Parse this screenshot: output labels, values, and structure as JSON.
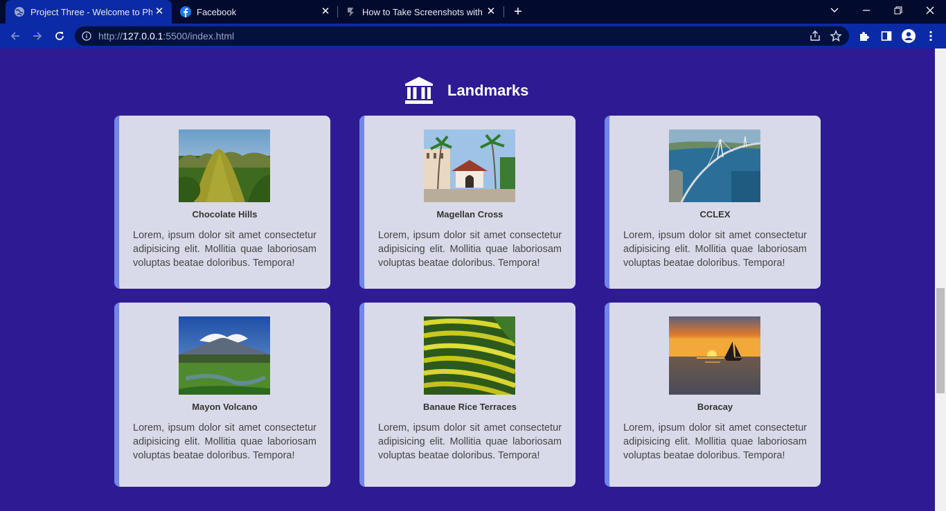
{
  "browser": {
    "tabs": [
      {
        "title": "Project Three - Welcome to Philip",
        "favicon": "globe-icon",
        "active": true
      },
      {
        "title": "Facebook",
        "favicon": "facebook-icon",
        "active": false
      },
      {
        "title": "How to Take Screenshots with Du",
        "favicon": "page-icon",
        "active": false
      }
    ],
    "new_tab": "+",
    "address": {
      "protocol": "http://",
      "host": "127.0.0.1",
      "path": ":5500/index.html"
    }
  },
  "colors": {
    "page_bg": "#2e1a93",
    "card_bg": "#d9dae9",
    "card_accent": "#7285e8",
    "chrome_bg": "#0b2aa6"
  },
  "section": {
    "title": "Landmarks",
    "icon": "bank-icon"
  },
  "landmarks": [
    {
      "name": "Chocolate Hills",
      "description": "Lorem, ipsum dolor sit amet consectetur adipisicing elit. Mollitia quae laboriosam voluptas beatae doloribus. Tempora!"
    },
    {
      "name": "Magellan Cross",
      "description": "Lorem, ipsum dolor sit amet consectetur adipisicing elit. Mollitia quae laboriosam voluptas beatae doloribus. Tempora!"
    },
    {
      "name": "CCLEX",
      "description": "Lorem, ipsum dolor sit amet consectetur adipisicing elit. Mollitia quae laboriosam voluptas beatae doloribus. Tempora!"
    },
    {
      "name": "Mayon Volcano",
      "description": "Lorem, ipsum dolor sit amet consectetur adipisicing elit. Mollitia quae laboriosam voluptas beatae doloribus. Tempora!"
    },
    {
      "name": "Banaue Rice Terraces",
      "description": "Lorem, ipsum dolor sit amet consectetur adipisicing elit. Mollitia quae laboriosam voluptas beatae doloribus. Tempora!"
    },
    {
      "name": "Boracay",
      "description": "Lorem, ipsum dolor sit amet consectetur adipisicing elit. Mollitia quae laboriosam voluptas beatae doloribus. Tempora!"
    }
  ]
}
